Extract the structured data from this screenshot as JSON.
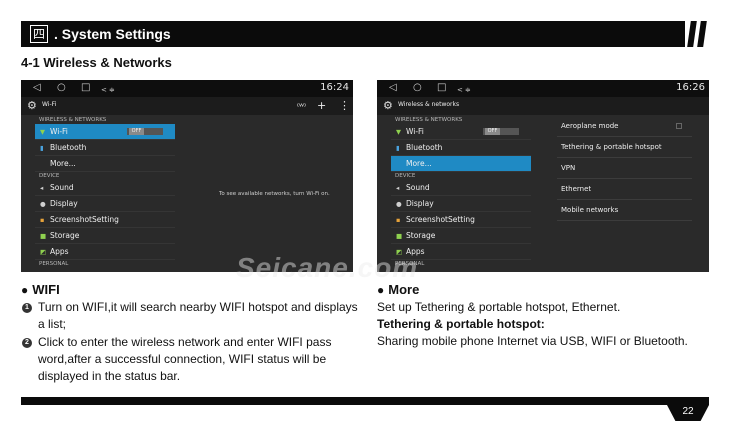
{
  "header": {
    "chapter_mark": "四",
    "title": ". System Settings"
  },
  "section_heading": "4-1 Wireless & Networks",
  "screens": {
    "left": {
      "nav": {
        "back": "◁",
        "home": "○",
        "recent": "□",
        "extra1": "<",
        "extra2": "≑",
        "time": "16:24"
      },
      "title": "Wi-Fi",
      "actions": [
        "⁽ᵂ⁾",
        "+",
        "⋮"
      ],
      "categories": [
        "WIRELESS & NETWORKS",
        "DEVICE",
        "PERSONAL"
      ],
      "wifi": "Wi-Fi",
      "toggle": "OFF",
      "bluetooth": "Bluetooth",
      "more": "More...",
      "sound": "Sound",
      "display": "Display",
      "screenshot": "ScreenshotSetting",
      "storage": "Storage",
      "apps": "Apps",
      "message": "To see available networks, turn Wi-Fi on."
    },
    "right": {
      "nav": {
        "back": "◁",
        "home": "○",
        "recent": "□",
        "extra1": "<",
        "extra2": "≑",
        "time": "16:26"
      },
      "title": "Wireless & networks",
      "categories": [
        "WIRELESS & NETWORKS",
        "DEVICE",
        "PERSONAL"
      ],
      "wifi": "Wi-Fi",
      "toggle": "OFF",
      "bluetooth": "Bluetooth",
      "more": "More...",
      "sound": "Sound",
      "display": "Display",
      "screenshot": "ScreenshotSetting",
      "storage": "Storage",
      "apps": "Apps",
      "options": [
        "Aeroplane mode",
        "Tethering & portable hotspot",
        "VPN",
        "Ethernet",
        "Mobile networks"
      ]
    }
  },
  "watermark": "Seicane.com",
  "wifi_section": {
    "title": "WIFI",
    "step1": "Turn on WIFI,it will search nearby WIFI hotspot and displays a list;",
    "step2": "Click to enter the wireless network and enter WIFI pass word,after a successful connection, WIFI status will be displayed in the status bar."
  },
  "more_section": {
    "title": "More",
    "line1": "Set up Tethering & portable hotspot, Ethernet.",
    "bold_heading": "Tethering & portable hotspot:",
    "line2": "Sharing mobile phone Internet via USB, WIFI or Bluetooth."
  },
  "page_number": "22",
  "colors": {
    "accent": "#1f8ac4",
    "header": "#0b0b0b",
    "screen_bg": "#2a2a2a"
  }
}
